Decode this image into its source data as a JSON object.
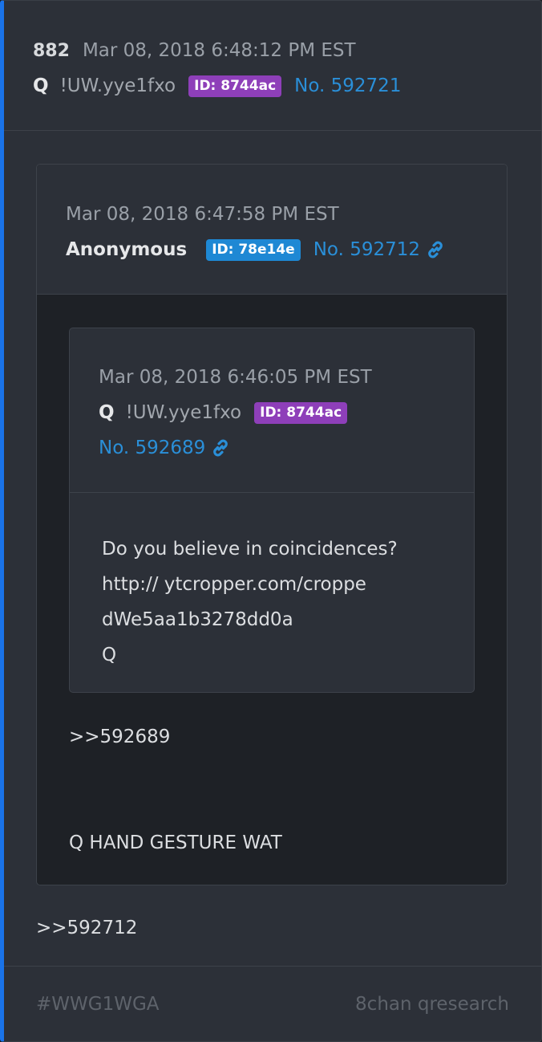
{
  "post": {
    "number": "882",
    "date": "Mar 08, 2018 6:48:12 PM EST",
    "author": "Q",
    "tripcode": "!UW.yye1fxo",
    "id_badge": "ID: 8744ac",
    "post_no": "No. 592721",
    "reply": ">>592712"
  },
  "quote1": {
    "date": "Mar 08, 2018 6:47:58 PM EST",
    "author": "Anonymous",
    "id_badge": "ID: 78e14e",
    "post_no": "No. 592712",
    "reply_ref": ">>592689",
    "text": "Q HAND GESTURE WAT"
  },
  "quote2": {
    "date": "Mar 08, 2018 6:46:05 PM EST",
    "author": "Q",
    "tripcode": "!UW.yye1fxo",
    "id_badge": "ID: 8744ac",
    "post_no": "No. 592689",
    "lines": [
      "Do you believe in coincidences?",
      "http:// ytcropper.com/croppe",
      "dWe5aa1b3278dd0a",
      "Q"
    ]
  },
  "footer": {
    "hashtag": "#WWG1WGA",
    "source": "8chan qresearch"
  },
  "colors": {
    "accent_bar": "#1a73e8",
    "link": "#2a8fd8",
    "badge_q": "#8e3fb9",
    "badge_anon": "#1e88d4"
  },
  "icons": [
    "link-icon"
  ]
}
